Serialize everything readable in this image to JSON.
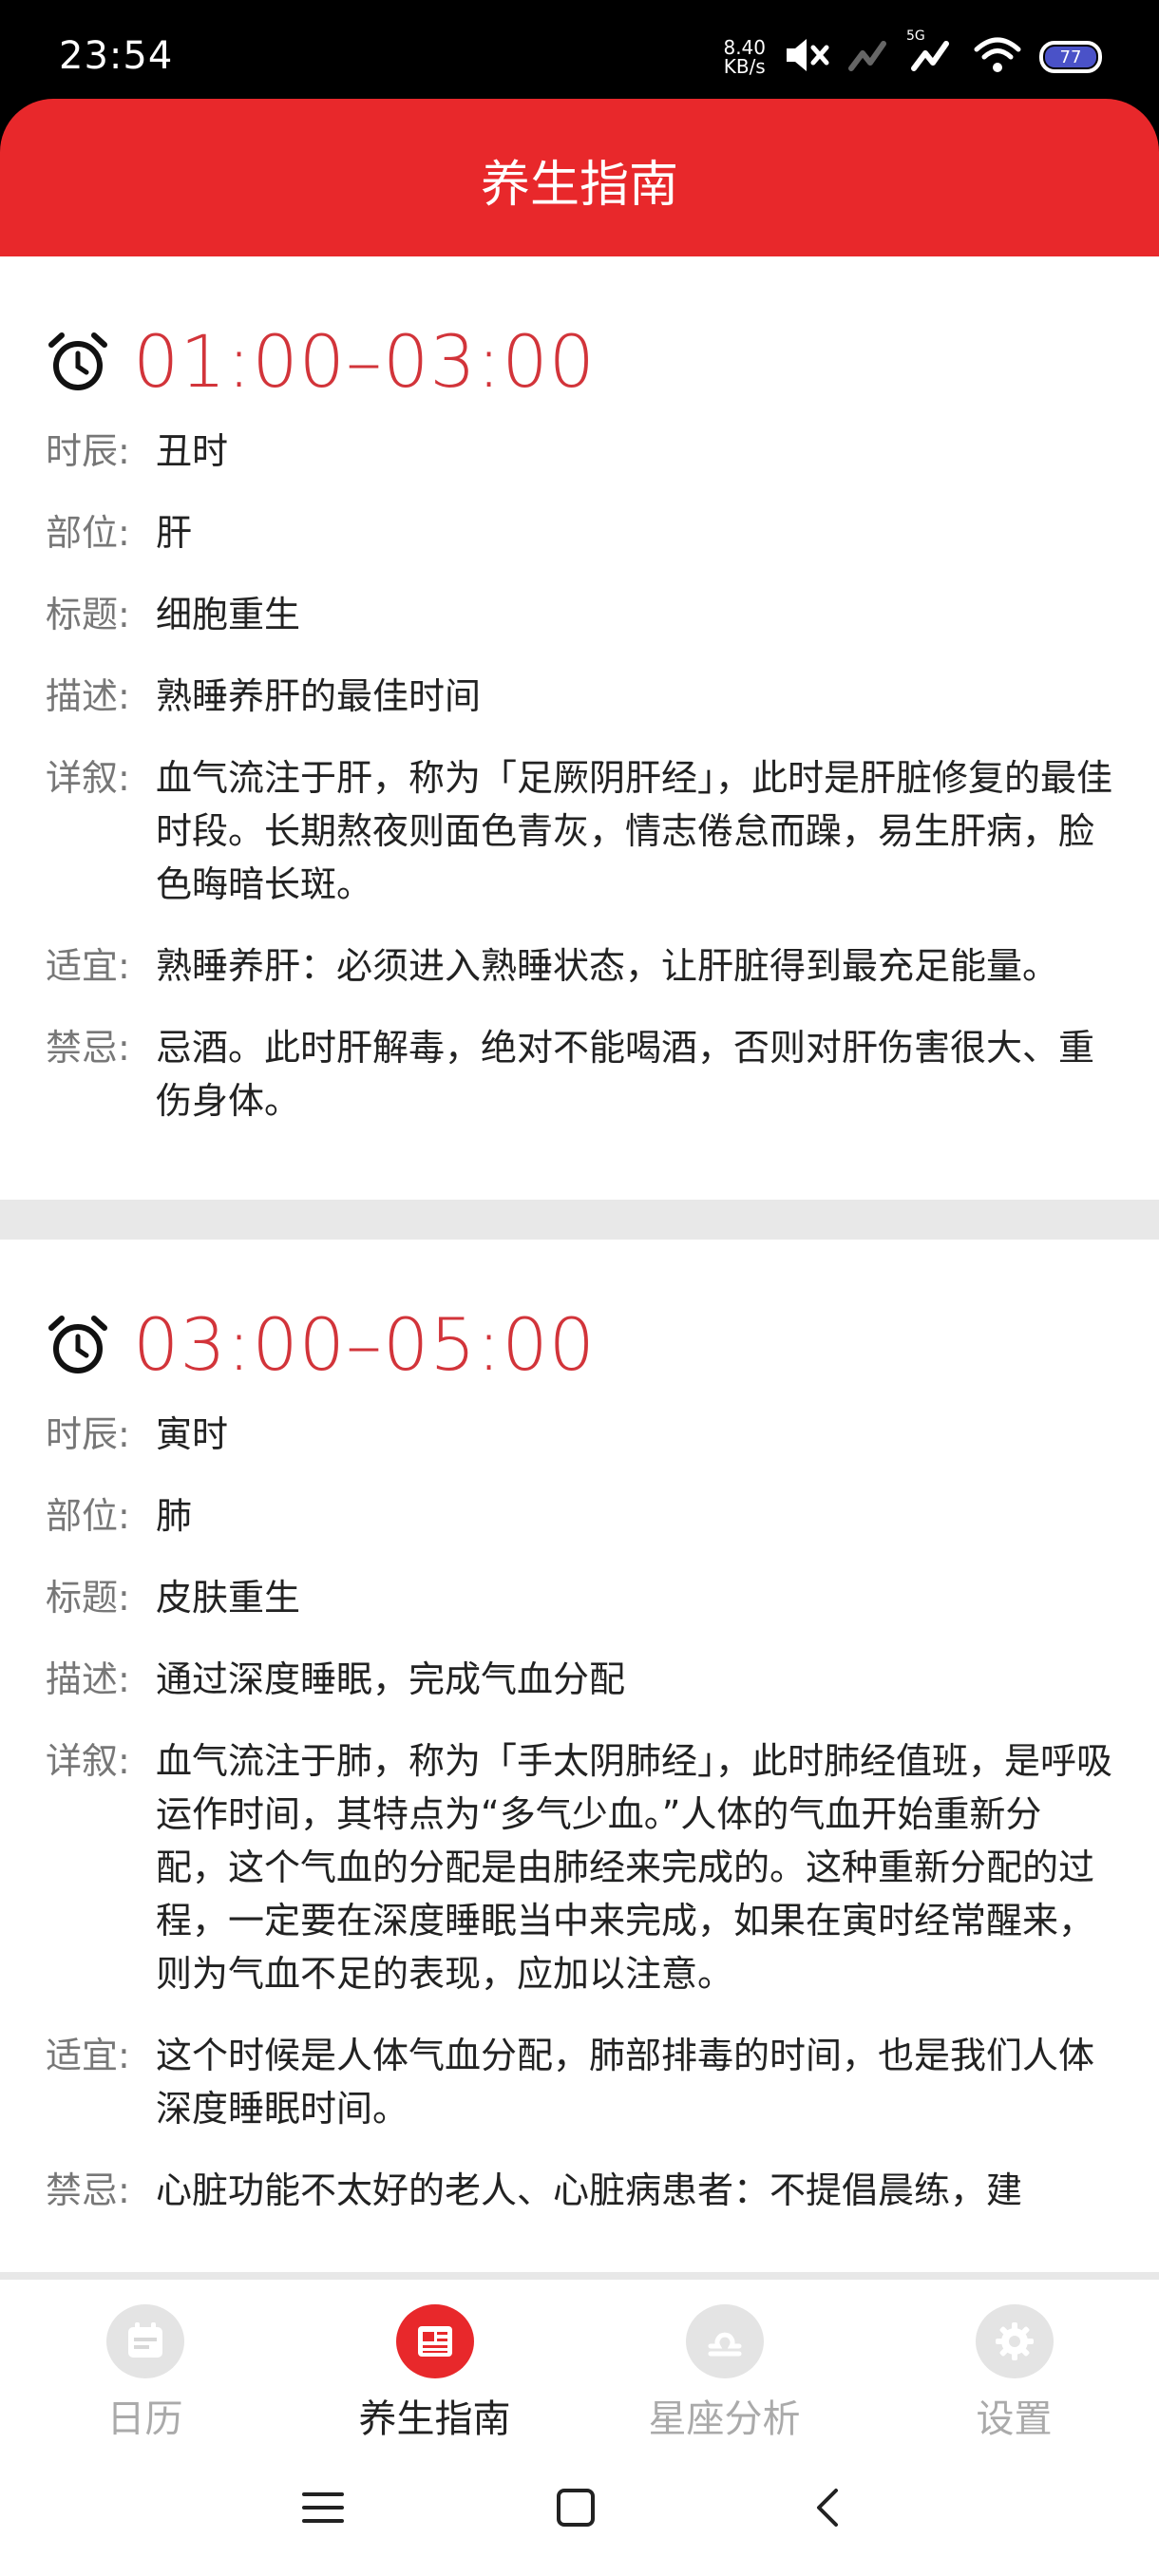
{
  "status_bar": {
    "time": "23:54",
    "net_speed_value": "8.40",
    "net_speed_unit": "KB/s",
    "network_type": "5G",
    "battery": "77"
  },
  "header": {
    "title": "养生指南"
  },
  "labels": {
    "shichen": "时辰:",
    "buwei": "部位:",
    "biaoti": "标题:",
    "miaoshu": "描述:",
    "xiangxu": "详叙:",
    "shiyi": "适宜:",
    "jinji": "禁忌:"
  },
  "sections": [
    {
      "time_range": "01:00–03:00",
      "shichen": "丑时",
      "buwei": "肝",
      "biaoti": "细胞重生",
      "miaoshu": "熟睡养肝的最佳时间",
      "xiangxu": "血气流注于肝，称为「足厥阴肝经」，此时是肝脏修复的最佳时段。长期熬夜则面色青灰，情志倦怠而躁，易生肝病，脸色晦暗长斑。",
      "shiyi": "熟睡养肝：必须进入熟睡状态，让肝脏得到最充足能量。",
      "jinji": "忌酒。此时肝解毒，绝对不能喝酒，否则对肝伤害很大、重伤身体。"
    },
    {
      "time_range": "03:00–05:00",
      "shichen": "寅时",
      "buwei": "肺",
      "biaoti": "皮肤重生",
      "miaoshu": "通过深度睡眠，完成气血分配",
      "xiangxu": "血气流注于肺，称为「手太阴肺经」，此时肺经值班，是呼吸运作时间，其特点为“多气少血。”人体的气血开始重新分配，这个气血的分配是由肺经来完成的。这种重新分配的过程，一定要在深度睡眠当中来完成，如果在寅时经常醒来，则为气血不足的表现，应加以注意。",
      "shiyi": "这个时候是人体气血分配，肺部排毒的时间，也是我们人体深度睡眠时间。",
      "jinji": "心脏功能不太好的老人、心脏病患者：不提倡晨练，建"
    }
  ],
  "tabs": [
    {
      "label": "日历",
      "icon": "calendar-icon",
      "active": false
    },
    {
      "label": "养生指南",
      "icon": "news-icon",
      "active": true
    },
    {
      "label": "星座分析",
      "icon": "libra-icon",
      "active": false
    },
    {
      "label": "设置",
      "icon": "gear-icon",
      "active": false
    }
  ],
  "colors": {
    "brand_red": "#e8282b",
    "time_red": "#d2343a"
  }
}
